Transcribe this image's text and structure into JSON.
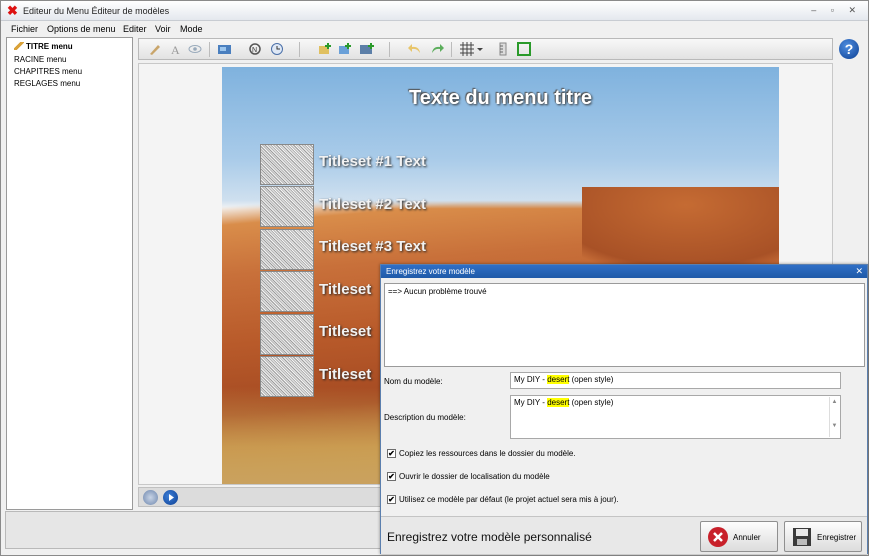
{
  "window": {
    "title": "Editeur du Menu Éditeur de modèles",
    "controls": "– ▫ ✕"
  },
  "menubar": {
    "items": [
      "Fichier",
      "Options de menu",
      "Editer",
      "Voir",
      "Mode"
    ]
  },
  "tree": {
    "items": [
      "TITRE menu",
      "RACINE menu",
      "CHAPITRES menu",
      "REGLAGES menu"
    ]
  },
  "toolbar": {
    "help_label": "?"
  },
  "preview": {
    "title": "Texte du menu titre",
    "titlesets": [
      "Titleset #1 Text",
      "Titleset #2 Text",
      "Titleset #3 Text",
      "Titleset",
      "Titleset",
      "Titleset"
    ]
  },
  "dialog": {
    "title": "Enregistrez votre modèle",
    "close": "✕",
    "log_text": "==> Aucun problème trouvé",
    "name_label": "Nom du modèle:",
    "name_prefix": "My DIY - ",
    "name_highlight": "desert",
    "name_suffix": " (open style)",
    "desc_label": "Description du modèle:",
    "desc_prefix": "My DIY - ",
    "desc_highlight": "desert",
    "desc_suffix": " (open style)",
    "checkboxes": [
      "Copiez les ressources dans le dossier du modèle.",
      "Ouvrir le dossier de localisation du modèle",
      "Utilisez ce modèle par défaut (le projet actuel sera mis à jour)."
    ],
    "footer_message": "Enregistrez votre modèle personnalisé",
    "cancel_label": "Annuler",
    "save_label": "Enregistrer"
  },
  "colors": {
    "accent": "#1f5aa8",
    "highlight": "#ffff00"
  }
}
